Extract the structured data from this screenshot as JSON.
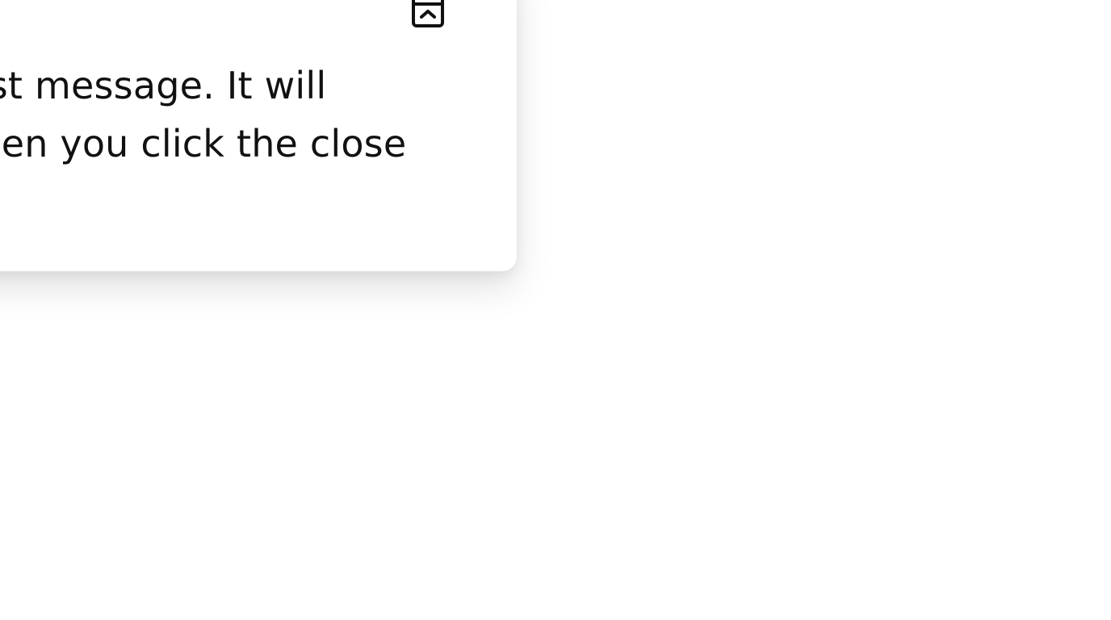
{
  "toast": {
    "message_line_1": "This is a toast message. It will",
    "message_line_2": "disappear when you click the close",
    "collapse_icon": "collapse-panel-up-icon"
  }
}
